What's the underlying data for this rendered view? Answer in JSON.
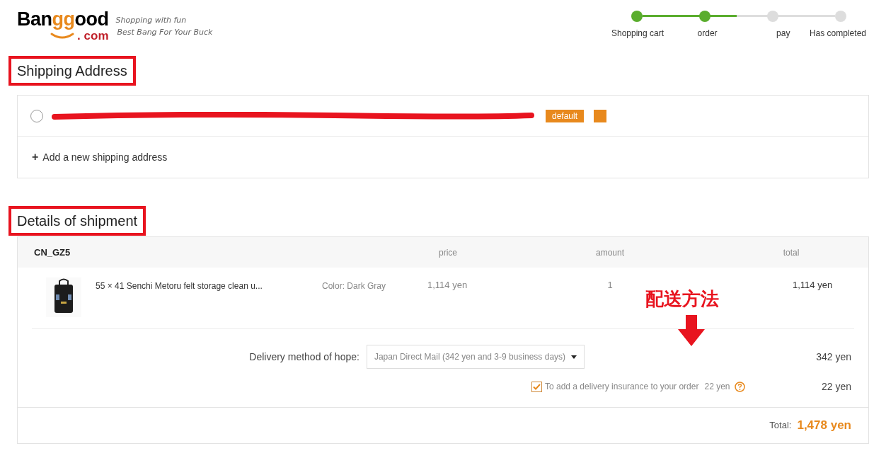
{
  "logo": {
    "wordmark_parts": [
      "Ban",
      "gg",
      "ood"
    ],
    "domain": ". com",
    "taglines": [
      "Shopping with fun",
      "Best Bang For Your Buck"
    ]
  },
  "steps": [
    {
      "label": "Shopping cart",
      "done": true
    },
    {
      "label": "order",
      "done": true
    },
    {
      "label": "pay",
      "done": false
    },
    {
      "label": "Has completed",
      "done": false
    }
  ],
  "progress": {
    "level": 0.49
  },
  "shipping_address": {
    "heading": "Shipping Address",
    "highlighted": true,
    "addresses": [
      {
        "selected": false,
        "redacted": true,
        "badge": "default"
      }
    ],
    "add_icon": "+",
    "add_label": "Add a new shipping address"
  },
  "shipment": {
    "heading": "Details of shipment",
    "highlighted": true,
    "warehouse": "CN_GZ5",
    "columns": [
      "price",
      "amount",
      "total"
    ],
    "items": [
      {
        "title": "55 × 41 Senchi Metoru felt storage clean u...",
        "variant": "Color: Dark Gray",
        "price": "1,114 yen",
        "amount": "1",
        "total": "1,114 yen"
      }
    ],
    "delivery": {
      "label": "Delivery method of hope:",
      "value": "Japan Direct Mail (342 yen and 3-9 business days)",
      "price": "342 yen"
    },
    "insurance": {
      "checked": true,
      "label": "To add a delivery insurance to your order",
      "fee": "22 yen",
      "price": "22 yen"
    },
    "total_label": "Total:",
    "total": "1,478 yen"
  },
  "annotation": {
    "text": "配送方法"
  }
}
